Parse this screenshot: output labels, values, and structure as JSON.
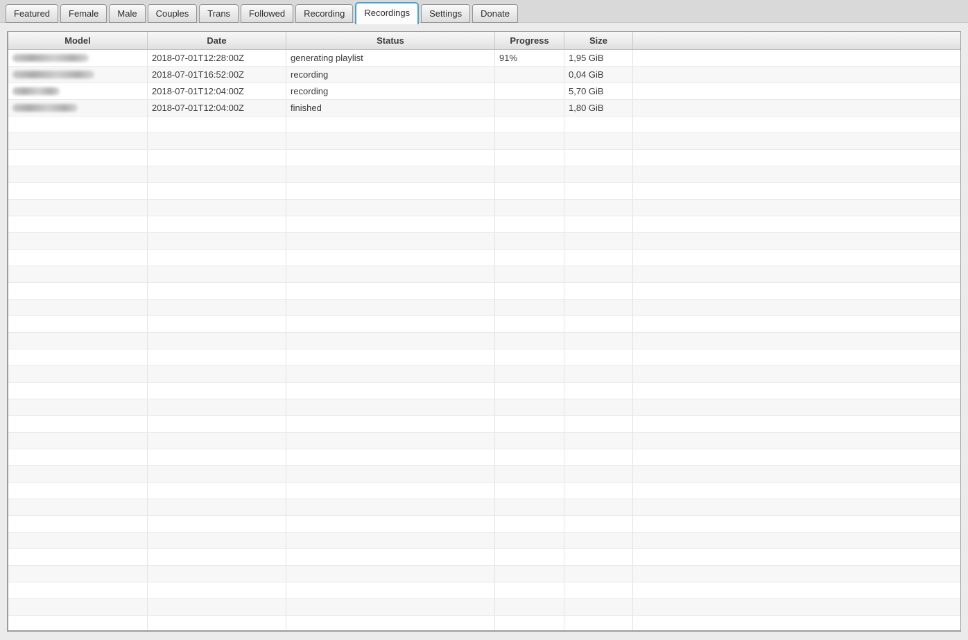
{
  "tabs": [
    {
      "label": "Featured",
      "selected": false
    },
    {
      "label": "Female",
      "selected": false
    },
    {
      "label": "Male",
      "selected": false
    },
    {
      "label": "Couples",
      "selected": false
    },
    {
      "label": "Trans",
      "selected": false
    },
    {
      "label": "Followed",
      "selected": false
    },
    {
      "label": "Recording",
      "selected": false
    },
    {
      "label": "Recordings",
      "selected": true
    },
    {
      "label": "Settings",
      "selected": false
    },
    {
      "label": "Donate",
      "selected": false
    }
  ],
  "table": {
    "columns": [
      {
        "label": "Model"
      },
      {
        "label": "Date"
      },
      {
        "label": "Status"
      },
      {
        "label": "Progress"
      },
      {
        "label": "Size"
      },
      {
        "label": ""
      }
    ],
    "rows": [
      {
        "model_redacted": true,
        "model_blur_width": 110,
        "date": "2018-07-01T12:28:00Z",
        "status": "generating playlist",
        "progress": "91%",
        "size": "1,95 GiB"
      },
      {
        "model_redacted": true,
        "model_blur_width": 118,
        "date": "2018-07-01T16:52:00Z",
        "status": "recording",
        "progress": "",
        "size": "0,04 GiB"
      },
      {
        "model_redacted": true,
        "model_blur_width": 68,
        "date": "2018-07-01T12:04:00Z",
        "status": "recording",
        "progress": "",
        "size": "5,70 GiB"
      },
      {
        "model_redacted": true,
        "model_blur_width": 94,
        "date": "2018-07-01T12:04:00Z",
        "status": "finished",
        "progress": "",
        "size": "1,80 GiB"
      }
    ],
    "empty_row_count": 31
  },
  "colors": {
    "selected_tab_border": "#4aa2d0",
    "page_background": "#ebebeb",
    "tabbar_background": "#d9d9d9",
    "row_alt": "#f7f7f7"
  }
}
